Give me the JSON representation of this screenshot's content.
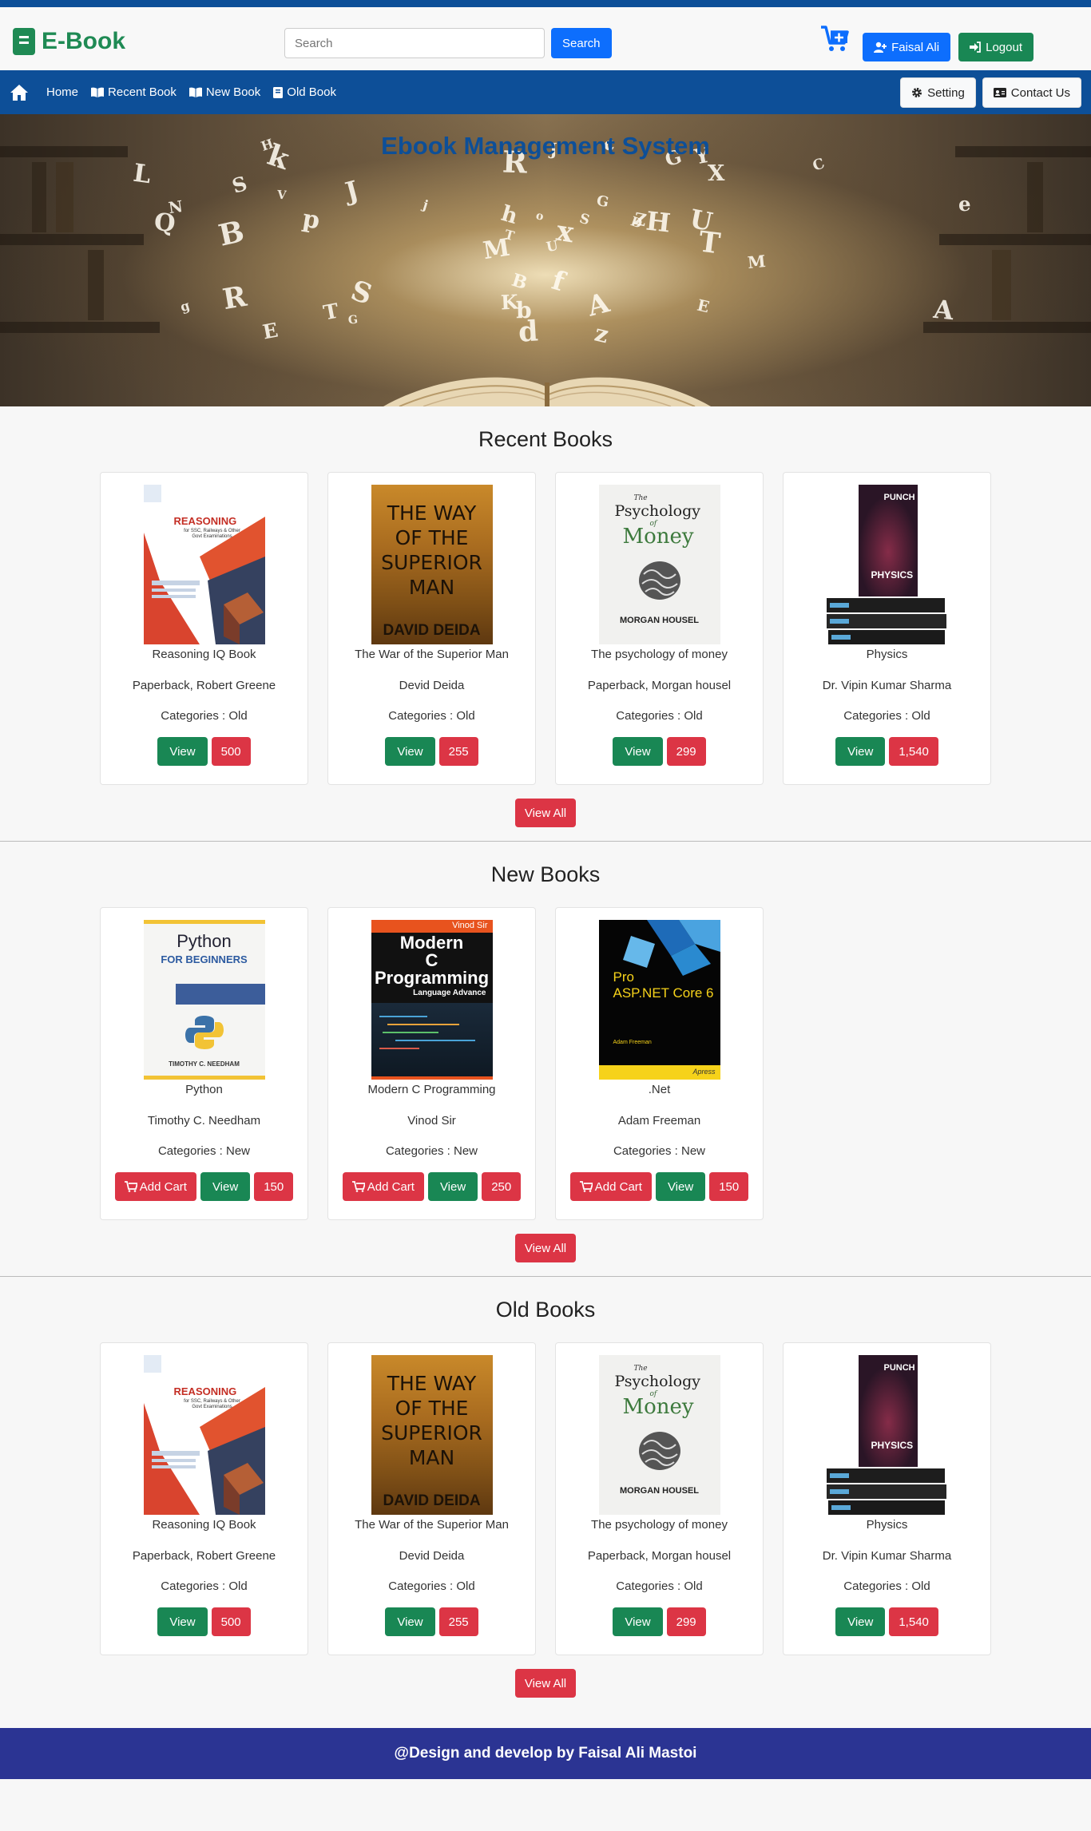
{
  "header": {
    "brand": "E-Book",
    "search_placeholder": "Search",
    "search_button": "Search",
    "user_label": "Faisal Ali",
    "logout_label": "Logout"
  },
  "nav": {
    "home": "Home",
    "recent": "Recent Book",
    "new": "New Book",
    "old": "Old Book",
    "setting": "Setting",
    "contact": "Contact Us"
  },
  "hero": {
    "title": "Ebook Management System"
  },
  "recent": {
    "heading": "Recent Books",
    "view_all": "View All",
    "books": [
      {
        "title": "Reasoning IQ Book",
        "author": "Paperback, Robert Greene",
        "category": "Categories : Old",
        "view": "View",
        "price": "500"
      },
      {
        "title": "The War of the Superior Man",
        "author": "Devid Deida",
        "category": "Categories : Old",
        "view": "View",
        "price": "255"
      },
      {
        "title": "The psychology of money",
        "author": "Paperback, Morgan housel",
        "category": "Categories : Old",
        "view": "View",
        "price": "299"
      },
      {
        "title": "Physics",
        "author": "Dr. Vipin Kumar Sharma",
        "category": "Categories : Old",
        "view": "View",
        "price": "1,540"
      }
    ]
  },
  "newbooks": {
    "heading": "New Books",
    "view_all": "View All",
    "books": [
      {
        "title": "Python",
        "author": "Timothy C. Needham",
        "category": "Categories : New",
        "cart": "Add Cart",
        "view": "View",
        "price": "150"
      },
      {
        "title": "Modern C Programming",
        "author": "Vinod Sir",
        "category": "Categories : New",
        "cart": "Add Cart",
        "view": "View",
        "price": "250"
      },
      {
        "title": ".Net",
        "author": "Adam Freeman",
        "category": "Categories : New",
        "cart": "Add Cart",
        "view": "View",
        "price": "150"
      }
    ]
  },
  "old": {
    "heading": "Old Books",
    "view_all": "View All",
    "books": [
      {
        "title": "Reasoning IQ Book",
        "author": "Paperback, Robert Greene",
        "category": "Categories : Old",
        "view": "View",
        "price": "500"
      },
      {
        "title": "The War of the Superior Man",
        "author": "Devid Deida",
        "category": "Categories : Old",
        "view": "View",
        "price": "255"
      },
      {
        "title": "The psychology of money",
        "author": "Paperback, Morgan housel",
        "category": "Categories : Old",
        "view": "View",
        "price": "299"
      },
      {
        "title": "Physics",
        "author": "Dr. Vipin Kumar Sharma",
        "category": "Categories : Old",
        "view": "View",
        "price": "1,540"
      }
    ]
  },
  "covers": {
    "reasoning_title": "REASONING",
    "reasoning_sub": "for SSC, Railways & Other Govt Examinations",
    "way_lines": [
      "THE WAY",
      "OF THE",
      "SUPERIOR",
      "MAN"
    ],
    "way_author": "DAVID DEIDA",
    "psy_the": "The",
    "psy_psychology": "Psychology",
    "psy_of": "of",
    "psy_money": "Money",
    "psy_author": "MORGAN HOUSEL",
    "phys_brand": "PUNCH",
    "phys_title": "PHYSICS",
    "py_title": "Python",
    "py_sub": "FOR BEGINNERS",
    "py_author": "TIMOTHY C. NEEDHAM",
    "c_author": "Vinod Sir",
    "c_title1": "Modern",
    "c_title2": "C",
    "c_title3": "Programming",
    "c_sub": "Language Advance",
    "net_pro": "Pro",
    "net_title": "ASP.NET Core 6",
    "net_author": "Adam Freeman",
    "net_publisher": "Apress"
  },
  "footer": {
    "text": "@Design and develop by Faisal Ali Mastoi"
  },
  "colors": {
    "primary_blue": "#0d4f98",
    "brand_green": "#1f8a54",
    "button_green": "#198754",
    "button_red": "#dc3545",
    "button_blue": "#0d6efd",
    "footer_bg": "#2b3493"
  }
}
